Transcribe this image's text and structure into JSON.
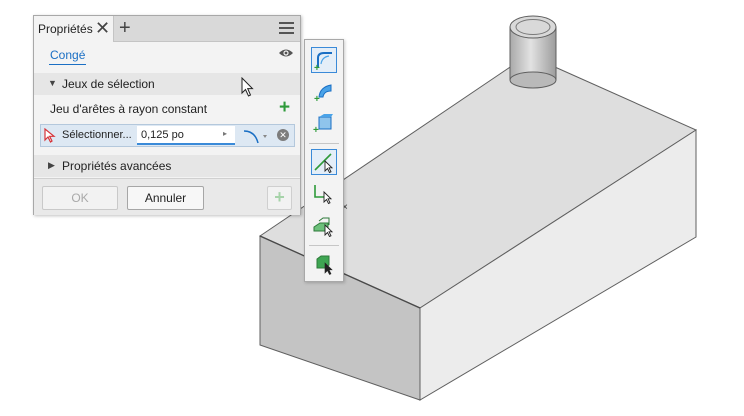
{
  "panel": {
    "tab_label": "Propriétés",
    "close_glyph": "✕",
    "add_glyph": "+",
    "feature_name": "Congé",
    "selection_sets": {
      "arrow": "▼",
      "title": "Jeux de sélection",
      "edge_set_label": "Jeu d'arêtes à rayon constant",
      "add_glyph": "+",
      "select_label": "Sélectionner...",
      "radius_value": "0,125 po",
      "input_arrow": "▸",
      "remove_glyph": "✕"
    },
    "advanced": {
      "arrow": "▶",
      "title": "Propriétés avancées"
    },
    "footer": {
      "ok_label": "OK",
      "cancel_label": "Annuler",
      "apply_glyph": "+"
    }
  },
  "toolstrip": {
    "items": [
      {
        "name": "add-fillet-edge-icon",
        "active": true
      },
      {
        "name": "add-fillet-face-icon",
        "active": false
      },
      {
        "name": "add-full-round-icon",
        "active": false
      },
      {
        "name": "select-edge-icon",
        "active": true
      },
      {
        "name": "select-loop-icon",
        "active": false
      },
      {
        "name": "select-feature-icon",
        "active": false
      },
      {
        "name": "select-all-edges-icon",
        "active": false
      }
    ]
  },
  "colors": {
    "accent": "#1a6fc4",
    "add_green": "#2e9a3a",
    "panel_bg": "#f3f3f3",
    "model_top": "#dedede",
    "model_front": "#ececec",
    "model_left": "#c4c4c4"
  }
}
